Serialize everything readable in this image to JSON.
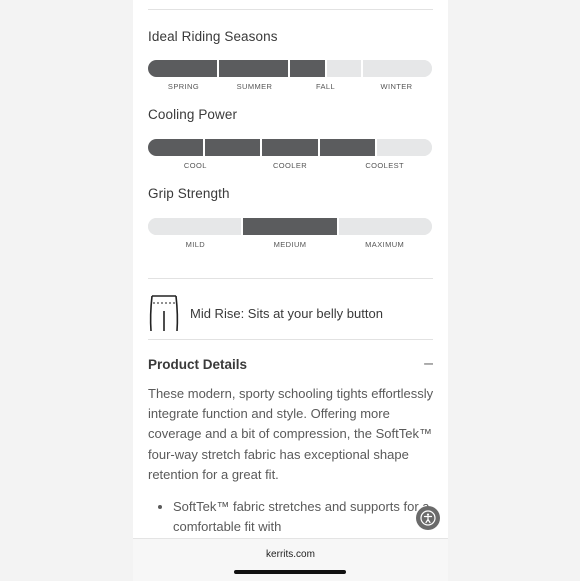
{
  "seasons": {
    "title": "Ideal Riding Seasons",
    "segments": [
      {
        "filled": true,
        "flex": 1
      },
      {
        "filled": true,
        "flex": 1
      },
      {
        "filled": true,
        "flex": 0.5
      },
      {
        "filled": false,
        "flex": 0.5
      },
      {
        "filled": false,
        "flex": 1
      }
    ],
    "labels": [
      "SPRING",
      "SUMMER",
      "FALL",
      "WINTER"
    ]
  },
  "cooling": {
    "title": "Cooling Power",
    "segments": [
      {
        "filled": true,
        "flex": 1
      },
      {
        "filled": true,
        "flex": 1
      },
      {
        "filled": true,
        "flex": 1
      },
      {
        "filled": true,
        "flex": 1
      },
      {
        "filled": false,
        "flex": 1
      }
    ],
    "labels": [
      "COOL",
      "COOLER",
      "COOLEST"
    ]
  },
  "grip": {
    "title": "Grip Strength",
    "segments": [
      {
        "filled": false,
        "flex": 1
      },
      {
        "filled": true,
        "flex": 1
      },
      {
        "filled": false,
        "flex": 1
      }
    ],
    "labels": [
      "MILD",
      "MEDIUM",
      "MAXIMUM"
    ]
  },
  "rise": {
    "text": "Mid Rise: Sits at your belly button",
    "icon": "tights-rise-icon"
  },
  "details": {
    "title": "Product Details",
    "toggle": "–",
    "description": "These modern, sporty schooling tights effortlessly integrate function and style. Offering more coverage and a bit of compression, the SoftTek™ four-way stretch fabric has exceptional shape retention for a great fit.",
    "bullets": [
      "SoftTek™ fabric stretches and supports for a comfortable fit with"
    ]
  },
  "footer": {
    "url": "kerrits.com"
  },
  "colors": {
    "filled": "#5b5c5e",
    "empty": "#e6e7e8",
    "a11y": "#6a6a6a"
  }
}
